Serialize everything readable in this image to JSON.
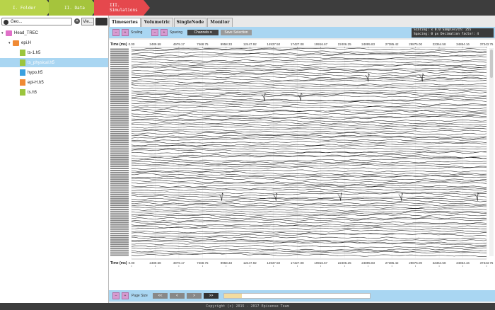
{
  "breadcrumbs": [
    {
      "label": "I. Folder",
      "color": "#b8d34a"
    },
    {
      "label": "II. Data",
      "color": "#a5c43c"
    },
    {
      "label": "III. Simulations",
      "color": "#e5484d"
    }
  ],
  "sidebar": {
    "search_value": "Geo...",
    "view_label": "Vie...",
    "tree": [
      {
        "label": "Head_TREC",
        "type": "folder",
        "level": 0,
        "color": "#e070c8"
      },
      {
        "label": "epi.H",
        "type": "folder",
        "level": 1,
        "color": "#f08a34"
      },
      {
        "label": "ts-1.h5",
        "type": "file",
        "level": 2,
        "color": "#9bc53d"
      },
      {
        "label": "ts_physical.h5",
        "type": "file",
        "level": 2,
        "color": "#9bc53d",
        "selected": true
      },
      {
        "label": "hypo.h5",
        "type": "file",
        "level": 2,
        "color": "#3aa0e0"
      },
      {
        "label": "epi-H.h5",
        "type": "file",
        "level": 2,
        "color": "#f08a34"
      },
      {
        "label": "ts.h5",
        "type": "file",
        "level": 2,
        "color": "#9bc53d"
      }
    ]
  },
  "tabs": [
    "Timeseries",
    "Volumetric",
    "SingleNode",
    "Monitor"
  ],
  "toolbar": {
    "scaling_label": "Scaling",
    "spacing_label": "Spacing",
    "channels_button": "Channels ▾",
    "save_button": "Save Selection",
    "info_line1": "Scaling: x 0.0   Samples/ch: 255",
    "info_line2": "Spacing: 0 px    Decimation factor: 4"
  },
  "bottom": {
    "page_size_label": "Page Size",
    "page_buttons": [
      "<<",
      "<",
      ">",
      ">>"
    ],
    "progress": 0.12
  },
  "footer": "Copyright (c) 2015 - 2017 Episense Team",
  "chart_data": {
    "type": "line",
    "xlabel": "Time (ms)",
    "x_ticks": [
      "0.00",
      "2489.58",
      "4979.17",
      "7468.75",
      "9958.33",
      "12447.92",
      "14937.50",
      "17427.08",
      "19916.67",
      "22406.25",
      "24895.83",
      "27385.42",
      "29875.00",
      "32364.58",
      "34854.16",
      "37343.75"
    ],
    "xlim": [
      0,
      37343.75
    ],
    "channel_count": 96,
    "channel_label_color": "#555555",
    "trace_color": "#222222",
    "grid": true,
    "spikes": [
      {
        "channel": 12,
        "x": 24895.83
      },
      {
        "channel": 12,
        "x": 30600.0
      },
      {
        "channel": 21,
        "x": 14000.0
      },
      {
        "channel": 21,
        "x": 17800.0
      },
      {
        "channel": 67,
        "x": 9500.0
      },
      {
        "channel": 67,
        "x": 15200.0
      },
      {
        "channel": 67,
        "x": 22000.0
      },
      {
        "channel": 67,
        "x": 28400.0
      },
      {
        "channel": 67,
        "x": 36400.0
      }
    ]
  }
}
